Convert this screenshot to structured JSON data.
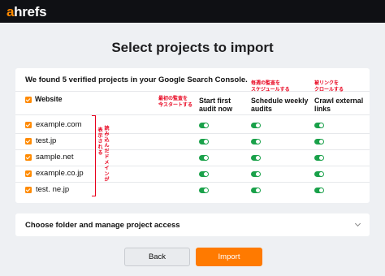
{
  "brand": {
    "logo_accent": "a",
    "logo_rest": "hrefs"
  },
  "page": {
    "title": "Select projects to import"
  },
  "panel": {
    "found_text": "We found 5 verified projects in your Google Search Console.",
    "column_website": "Website",
    "column_first_audit": [
      "Start first",
      "audit now"
    ],
    "column_schedule": [
      "Schedule weekly",
      "audits"
    ],
    "column_crawl": [
      "Crawl external",
      "links"
    ],
    "annotation_first_audit": [
      "最初の監査を",
      "今スタートする"
    ],
    "annotation_schedule": [
      "毎週の監査を",
      "スケジュールする"
    ],
    "annotation_crawl": [
      "被リンクを",
      "クロールする"
    ],
    "annotation_domains_col1": "読み込んだドメインが",
    "annotation_domains_col2": "表示される",
    "projects": [
      {
        "domain": "example.com",
        "checked": true,
        "first_audit": true,
        "schedule": true,
        "crawl": true
      },
      {
        "domain": "test.jp",
        "checked": true,
        "first_audit": true,
        "schedule": true,
        "crawl": true
      },
      {
        "domain": "sample.net",
        "checked": true,
        "first_audit": true,
        "schedule": true,
        "crawl": true
      },
      {
        "domain": "example.co.jp",
        "checked": true,
        "first_audit": true,
        "schedule": true,
        "crawl": true
      },
      {
        "domain": "test. ne.jp",
        "checked": true,
        "first_audit": true,
        "schedule": true,
        "crawl": true
      }
    ]
  },
  "folder": {
    "label": "Choose folder and manage project access"
  },
  "actions": {
    "back_label": "Back",
    "import_label": "Import"
  },
  "colors": {
    "brand_orange": "#ff8a00",
    "import_orange": "#ff7a00",
    "toggle_green": "#1aa14a",
    "annotation_red": "#e8001c",
    "topbar": "#0f1014"
  }
}
